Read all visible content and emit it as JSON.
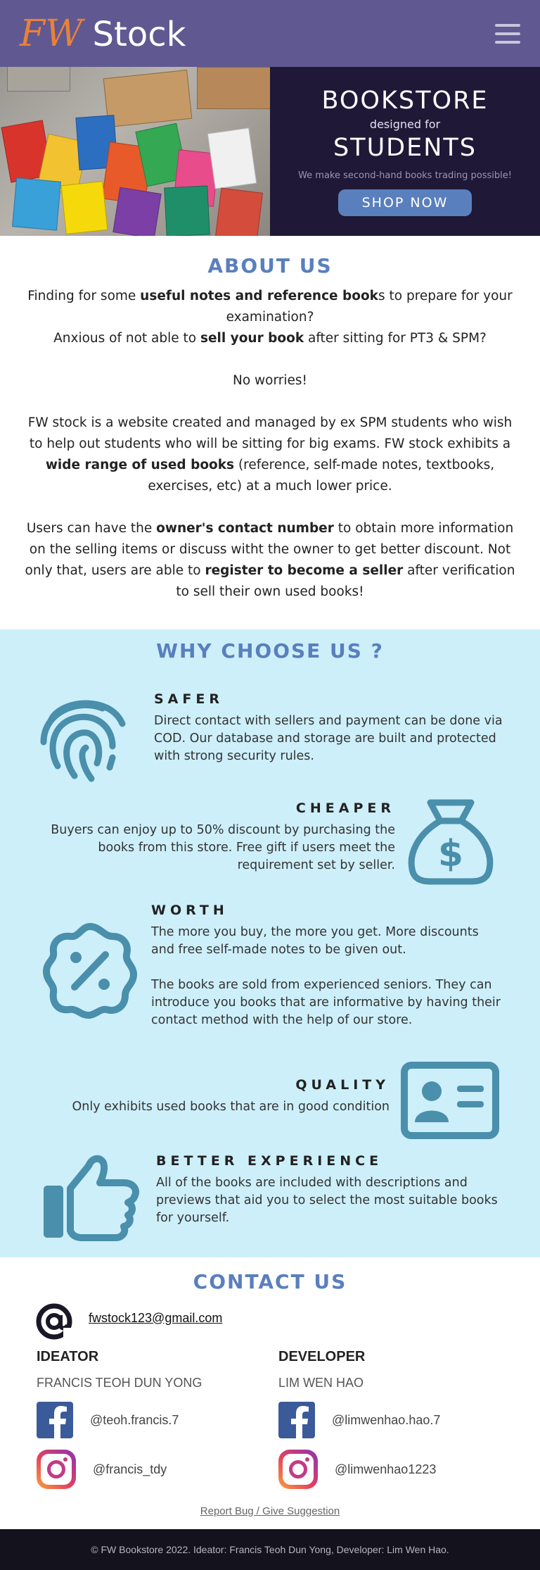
{
  "navbar": {
    "brand_fw": "FW",
    "brand_stock": "Stock",
    "menu_icon": "hamburger-menu-icon"
  },
  "hero": {
    "title": "BOOKSTORE",
    "subtitle": "designed for",
    "title2": "STUDENTS",
    "tagline": "We make second-hand books trading possible!",
    "button_label": "SHOP NOW",
    "accent_color": "#5a7fbd",
    "panel_color": "#1f1937"
  },
  "about": {
    "title": "ABOUT US",
    "p1_a": "Finding for some ",
    "p1_b": "useful notes and reference book",
    "p1_c": "s to prepare for your examination?",
    "p2_a": "Anxious of not able to ",
    "p2_b": "sell your book",
    "p2_c": " after sitting for PT3 & SPM?",
    "p3": "No worries!",
    "p4_a": "FW stock is a website created and managed by ex SPM students who wish to help out students who will be sitting for big exams. FW stock exhibits a ",
    "p4_b": "wide range of used books",
    "p4_c": " (reference, self-made notes, textbooks, exercises, etc) at a much lower price.",
    "p5_a": "Users can have the ",
    "p5_b": "owner's contact number",
    "p5_c": " to obtain more information on the selling items or discuss witht the owner to get better discount. Not only that, users are able to ",
    "p5_d": "register to become a seller",
    "p5_e": " after verification to sell their own used books!"
  },
  "why": {
    "title": "WHY CHOOSE US ?",
    "background": "#cdeffa",
    "icon_color": "#4a8fab",
    "features": [
      {
        "heading": "SAFER",
        "icon": "fingerprint-icon",
        "text": "Direct contact with sellers and payment can be done via COD. Our database and storage are built and protected with strong security rules."
      },
      {
        "heading": "CHEAPER",
        "icon": "money-bag-icon",
        "text": "Buyers can enjoy up to 50% discount by purchasing the books from this store. Free gift if users meet the requirement set by seller."
      },
      {
        "heading": "WORTH",
        "icon": "discount-badge-icon",
        "text": "The more you buy, the more you get. More discounts and free self-made notes to be given out.",
        "text2": "The books are sold from experienced seniors. They can introduce you books that are informative by having their contact method with the help of our store."
      },
      {
        "heading": "QUALITY",
        "icon": "id-card-icon",
        "text": "Only exhibits used books that are in good condition"
      },
      {
        "heading": "BETTER EXPERIENCE",
        "icon": "thumbs-up-icon",
        "text": "All of the books are included with descriptions and previews that aid you to select the most suitable books for yourself."
      }
    ]
  },
  "contact": {
    "title": "CONTACT US",
    "email_icon": "at-sign-icon",
    "email": "fwstock123@gmail.com",
    "ideator": {
      "role": "IDEATOR",
      "name": "FRANCIS TEOH DUN YONG",
      "facebook": "@teoh.francis.7",
      "instagram": "@francis_tdy"
    },
    "developer": {
      "role": "DEVELOPER",
      "name": "LIM WEN HAO",
      "facebook": "@limwenhao.hao.7",
      "instagram": "@limwenhao1223"
    },
    "report_link": "Report Bug / Give Suggestion"
  },
  "footer": {
    "text": "© FW Bookstore 2022. Ideator: Francis Teoh Dun Yong, Developer: Lim Wen Hao."
  }
}
